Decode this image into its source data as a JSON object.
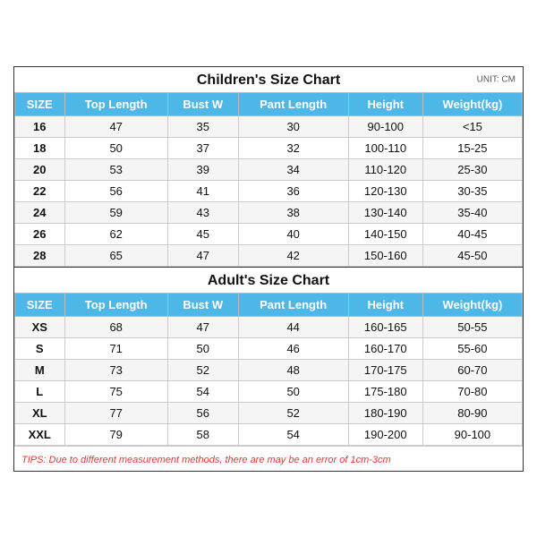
{
  "children_section": {
    "title": "Children's Size Chart",
    "unit": "UNIT: CM",
    "headers": [
      "SIZE",
      "Top Length",
      "Bust W",
      "Pant Length",
      "Height",
      "Weight(kg)"
    ],
    "rows": [
      [
        "16",
        "47",
        "35",
        "30",
        "90-100",
        "<15"
      ],
      [
        "18",
        "50",
        "37",
        "32",
        "100-110",
        "15-25"
      ],
      [
        "20",
        "53",
        "39",
        "34",
        "110-120",
        "25-30"
      ],
      [
        "22",
        "56",
        "41",
        "36",
        "120-130",
        "30-35"
      ],
      [
        "24",
        "59",
        "43",
        "38",
        "130-140",
        "35-40"
      ],
      [
        "26",
        "62",
        "45",
        "40",
        "140-150",
        "40-45"
      ],
      [
        "28",
        "65",
        "47",
        "42",
        "150-160",
        "45-50"
      ]
    ]
  },
  "adult_section": {
    "title": "Adult's Size Chart",
    "headers": [
      "SIZE",
      "Top Length",
      "Bust W",
      "Pant Length",
      "Height",
      "Weight(kg)"
    ],
    "rows": [
      [
        "XS",
        "68",
        "47",
        "44",
        "160-165",
        "50-55"
      ],
      [
        "S",
        "71",
        "50",
        "46",
        "160-170",
        "55-60"
      ],
      [
        "M",
        "73",
        "52",
        "48",
        "170-175",
        "60-70"
      ],
      [
        "L",
        "75",
        "54",
        "50",
        "175-180",
        "70-80"
      ],
      [
        "XL",
        "77",
        "56",
        "52",
        "180-190",
        "80-90"
      ],
      [
        "XXL",
        "79",
        "58",
        "54",
        "190-200",
        "90-100"
      ]
    ]
  },
  "tips": "TIPS: Due to different measurement methods, there are may be an error of 1cm-3cm"
}
